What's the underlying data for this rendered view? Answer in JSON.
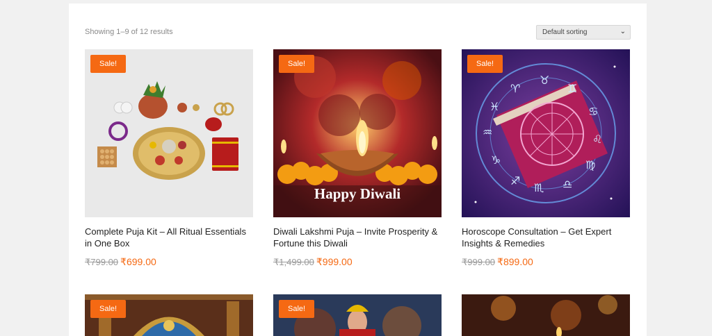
{
  "shop": {
    "result_count": "Showing 1–9 of 12 results",
    "sorting": "Default sorting"
  },
  "products": [
    {
      "sale": "Sale!",
      "title": "Complete Puja Kit – All Ritual Essentials in One Box",
      "old_price": "₹799.00",
      "price": "₹699.00"
    },
    {
      "sale": "Sale!",
      "title": "Diwali Lakshmi Puja – Invite Prosperity & Fortune this Diwali",
      "old_price": "₹1,499.00",
      "price": "₹999.00",
      "image_text": "Happy Diwali"
    },
    {
      "sale": "",
      "title": "Horoscope Consultation – Get Expert Insights & Remedies",
      "old_price": "₹999.00",
      "price": "₹899.00"
    },
    {
      "sale": "Sale!"
    },
    {
      "sale": "Sale!"
    },
    {
      "sale": ""
    }
  ],
  "colors": {
    "accent": "#f56913",
    "background": "#f1f1f1"
  }
}
